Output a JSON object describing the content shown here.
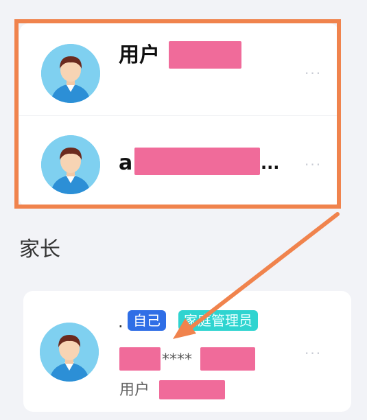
{
  "accounts": [
    {
      "name_prefix": "用户",
      "more": "···"
    },
    {
      "name_prefix": "a",
      "name_suffix": "...",
      "more": "···"
    }
  ],
  "section": {
    "title": "家长"
  },
  "member": {
    "prefix": ".",
    "self_badge": "自己",
    "role_badge": "家庭管理员",
    "masked": "****",
    "sub_label": "用户",
    "more": "···"
  },
  "colors": {
    "highlight": "#f0834d",
    "redaction": "#f06b9a",
    "self_badge_bg": "#2f6ee6",
    "role_badge_bg": "#2fd4d0",
    "avatar_bg": "#7fd0f0"
  }
}
